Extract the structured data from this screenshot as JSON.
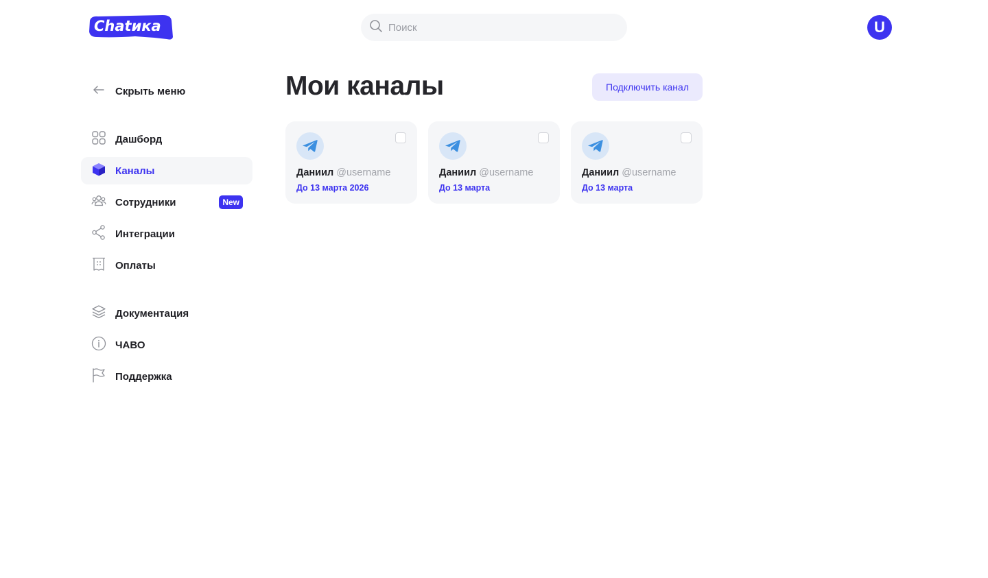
{
  "header": {
    "logo_text": "Chatика",
    "search_placeholder": "Поиск",
    "avatar_letter": "U"
  },
  "sidebar": {
    "hide_menu_label": "Скрыть меню",
    "items": [
      {
        "label": "Дашборд",
        "icon": "dashboard-icon",
        "active": false
      },
      {
        "label": "Каналы",
        "icon": "cube-icon",
        "active": true
      },
      {
        "label": "Сотрудники",
        "icon": "users-icon",
        "active": false,
        "badge": "New"
      },
      {
        "label": "Интеграции",
        "icon": "share-icon",
        "active": false
      },
      {
        "label": "Оплаты",
        "icon": "receipt-icon",
        "active": false
      }
    ],
    "secondary_items": [
      {
        "label": "Документация",
        "icon": "layers-icon"
      },
      {
        "label": "ЧАВО",
        "icon": "info-icon"
      },
      {
        "label": "Поддержка",
        "icon": "flag-icon"
      }
    ]
  },
  "main": {
    "title": "Мои каналы",
    "connect_button": "Подключить канал",
    "cards": [
      {
        "name": "Даниил",
        "username": "@username",
        "date": "До 13 марта 2026",
        "icon": "telegram-icon"
      },
      {
        "name": "Даниил",
        "username": "@username",
        "date": "До 13 марта",
        "icon": "telegram-icon"
      },
      {
        "name": "Даниил",
        "username": "@username",
        "date": "До 13 марта",
        "icon": "telegram-icon"
      }
    ]
  },
  "colors": {
    "accent": "#3d33f0",
    "card_bg": "#f5f6f8",
    "button_bg": "#ebeafd",
    "telegram": "#3b8fe0"
  }
}
